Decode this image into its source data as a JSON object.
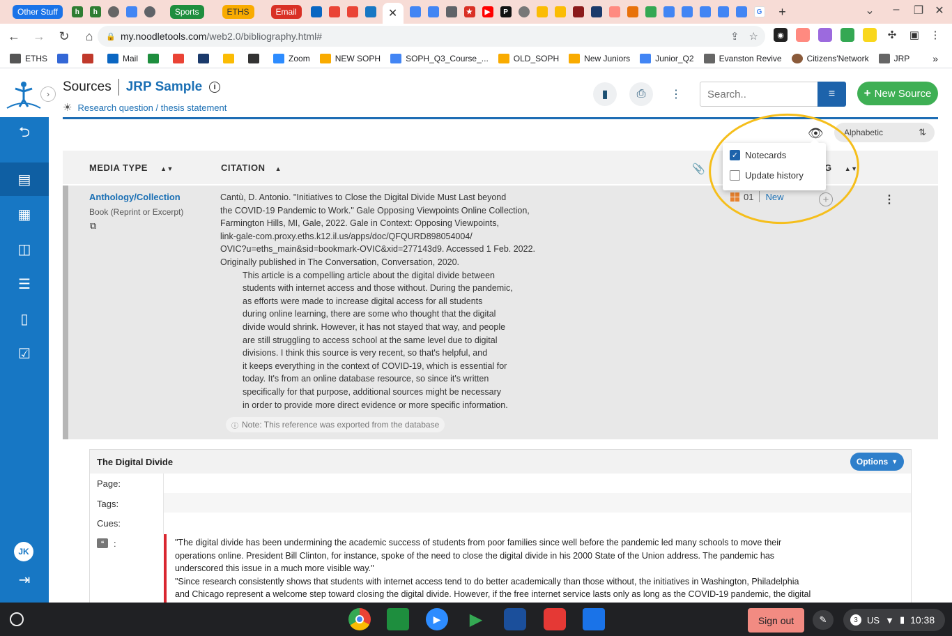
{
  "browser": {
    "tab_groups": [
      {
        "label": "Other Stuff",
        "color": "#1a73e8"
      },
      {
        "label": "Sports",
        "color": "#1e8e3e"
      },
      {
        "label": "ETHS",
        "color": "#f9ab00"
      },
      {
        "label": "Email",
        "color": "#d93025"
      }
    ],
    "active_tab_close": "✕",
    "new_tab": "+",
    "url_host": "my.noodletools.com",
    "url_path": "/web2.0/bibliography.html#"
  },
  "bookmarks": [
    {
      "label": "ETHS",
      "color": "#555"
    },
    {
      "label": "",
      "color": "#3367d6"
    },
    {
      "label": "",
      "color": "#c0392b"
    },
    {
      "label": "Mail",
      "color": "#0a66c2"
    },
    {
      "label": "",
      "color": "#1e8e3e"
    },
    {
      "label": "",
      "color": "#ea4335"
    },
    {
      "label": "",
      "color": "#1b3a6b"
    },
    {
      "label": "",
      "color": "#fbbc04"
    },
    {
      "label": "",
      "color": "#333"
    },
    {
      "label": "Zoom",
      "color": "#2d8cff"
    },
    {
      "label": "NEW SOPH",
      "color": "#f9ab00"
    },
    {
      "label": "SOPH_Q3_Course_...",
      "color": "#4285f4"
    },
    {
      "label": "OLD_SOPH",
      "color": "#f9ab00"
    },
    {
      "label": "New Juniors",
      "color": "#f9ab00"
    },
    {
      "label": "Junior_Q2",
      "color": "#4285f4"
    },
    {
      "label": "Evanston Revive",
      "color": "#666"
    },
    {
      "label": "Citizens'Network",
      "color": "#8a5a3a"
    },
    {
      "label": "JRP",
      "color": "#666"
    }
  ],
  "header": {
    "section": "Sources",
    "project": "JRP Sample",
    "research_link": "Research question / thesis statement",
    "search_placeholder": "Search..",
    "new_source": "New Source"
  },
  "sidebar": {
    "user_initials": "JK"
  },
  "toolbar": {
    "sort_label": "Alphabetic"
  },
  "table": {
    "col_media": "MEDIA TYPE",
    "col_citation": "CITATION",
    "col_g": "G"
  },
  "dropdown": {
    "items": [
      {
        "label": "Notecards",
        "checked": true
      },
      {
        "label": "Update history",
        "checked": false
      }
    ]
  },
  "source": {
    "media_type": "Anthology/Collection",
    "media_sub": "Book (Reprint or Excerpt)",
    "citation_lines": [
      "Cantù, D. Antonio. \"Initiatives to Close the Digital Divide Must Last beyond",
      "the COVID-19 Pandemic to Work.\" Gale Opposing Viewpoints Online Collection,",
      "Farmington Hills, MI, Gale, 2022. Gale in Context: Opposing Viewpoints,",
      "link-gale-com.proxy.eths.k12.il.us/apps/doc/QFQURD898054004/",
      "OVIC?u=eths_main&sid=bookmark-OVIC&xid=277143d9. Accessed 1 Feb. 2022.",
      "Originally published in The Conversation, Conversation, 2020."
    ],
    "annotation_lines": [
      "This article is a compelling article about the digital divide between",
      "students with internet access and those without. During the pandemic,",
      "as efforts were made to increase digital access for all students",
      "during online learning, there are some who thought that the digital",
      "divide would shrink. However, it has not stayed that way, and people",
      "are still struggling to access school at the same level due to digital",
      "divisions. I think this source is very recent, so that's helpful, and",
      "it keeps everything in the context of COVID-19, which is essential for",
      "today. It's from an online database resource, so since it's written",
      "specifically for that purpose, additional sources might be necessary",
      "in order to provide more direct evidence or more specific information."
    ],
    "note": "Note: This reference was exported from the database",
    "notecard_count": "01",
    "status": "New"
  },
  "notecard": {
    "title": "The Digital Divide",
    "options": "Options",
    "page_label": "Page:",
    "tags_label": "Tags:",
    "cues_label": "Cues:",
    "quote_label": ":",
    "quote_lines": [
      "\"The digital divide has been undermining the academic success of students from poor families since well before the pandemic led many schools to move their",
      "operations online. President Bill Clinton, for instance, spoke of the need to close the digital divide in his 2000 State of the Union address. The pandemic has",
      "underscored this issue in a much more visible way.\"",
      "\"Since research consistently shows that students with internet access tend to do better academically than those without, the initiatives in Washington, Philadelphia",
      "and Chicago represent a welcome step toward closing the digital divide. However, if the free internet service lasts only as long as the COVID-19 pandemic, the digital"
    ]
  },
  "shelf": {
    "sign_out": "Sign out",
    "notif_count": "3",
    "locale": "US",
    "time": "10:38"
  }
}
